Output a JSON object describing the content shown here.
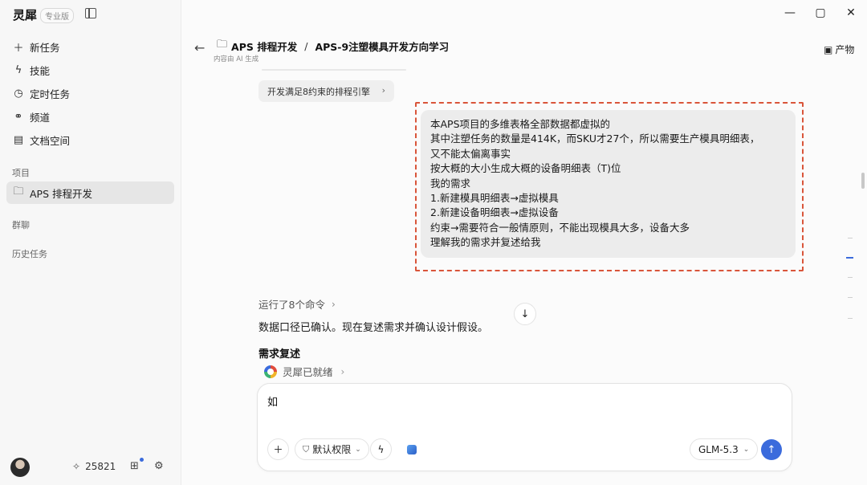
{
  "app": {
    "brand": "灵犀",
    "edition": "专业版"
  },
  "sidebar": {
    "items": [
      {
        "label": "新任务",
        "icon": "plus-icon"
      },
      {
        "label": "技能",
        "icon": "lightning-icon"
      },
      {
        "label": "定时任务",
        "icon": "clock-icon"
      },
      {
        "label": "频道",
        "icon": "link-icon"
      },
      {
        "label": "文档空间",
        "icon": "document-icon"
      }
    ],
    "sections": {
      "projects": "项目",
      "group_chat": "群聊",
      "history": "历史任务"
    },
    "project_item": "APS 排程开发",
    "footer": {
      "credits": "25821"
    }
  },
  "header": {
    "folder": "APS 排程开发",
    "separator": "/",
    "title": "APS-9注塑模具开发方向学习",
    "ai_note": "内容由 AI 生成",
    "artifact_label": "产物"
  },
  "chat": {
    "chip_label": "开发满足8约束的排程引擎",
    "user_message": [
      "本APS项目的多维表格全部数据都虚拟的",
      "其中注塑任务的数量是414K，而SKU才27个，所以需要生产模具明细表，",
      "又不能太偏离事实",
      "按大概的大小生成大概的设备明细表（T)位",
      "我的需求",
      "1.新建模具明细表→虚拟模具",
      "2.新建设备明细表→虚拟设备",
      "约束→需要符合一般情原则，不能出现模具大多，设备大多",
      "理解我的需求并复述给我"
    ],
    "ran_commands": "运行了8个命令",
    "confirm_text": "数据口径已确认。现在复述需求并确认设计假设。",
    "section_heading": "需求复述",
    "status": "灵犀已就绪"
  },
  "composer": {
    "value": "如",
    "permission_label": "默认权限",
    "model_label": "GLM-5.3"
  },
  "colors": {
    "accent": "#3b6bdc",
    "highlight_border": "#d9553a"
  }
}
